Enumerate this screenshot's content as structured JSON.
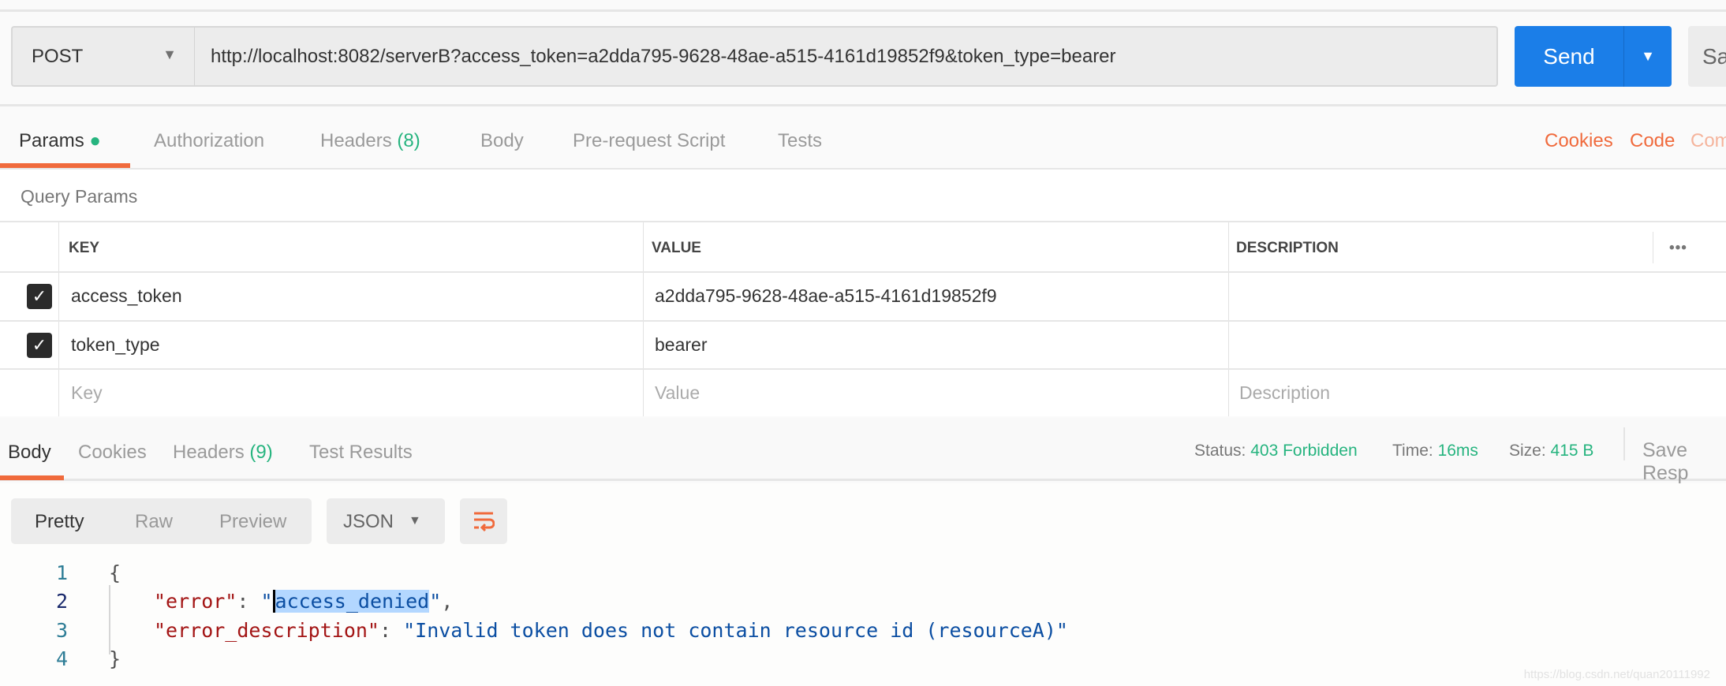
{
  "request": {
    "method": "POST",
    "url": "http://localhost:8082/serverB?access_token=a2dda795-9628-48ae-a515-4161d19852f9&token_type=bearer",
    "send_label": "Send",
    "save_label": "Sa"
  },
  "tabs": [
    {
      "label": "Params"
    },
    {
      "label": "Authorization"
    },
    {
      "label": "Headers",
      "count": "(8)"
    },
    {
      "label": "Body"
    },
    {
      "label": "Pre-request Script"
    },
    {
      "label": "Tests"
    }
  ],
  "right_links": {
    "cookies": "Cookies",
    "code": "Code",
    "comments": "Com"
  },
  "query_params": {
    "title": "Query Params",
    "headers": {
      "key": "KEY",
      "value": "VALUE",
      "description": "DESCRIPTION"
    },
    "rows": [
      {
        "checked": true,
        "key": "access_token",
        "value": "a2dda795-9628-48ae-a515-4161d19852f9"
      },
      {
        "checked": true,
        "key": "token_type",
        "value": "bearer"
      }
    ],
    "placeholders": {
      "key": "Key",
      "value": "Value",
      "description": "Description"
    },
    "more": "•••"
  },
  "response": {
    "tabs": [
      {
        "label": "Body"
      },
      {
        "label": "Cookies"
      },
      {
        "label": "Headers",
        "count": "(9)"
      },
      {
        "label": "Test Results"
      }
    ],
    "status_label": "Status:",
    "status": "403 Forbidden",
    "time_label": "Time:",
    "time": "16ms",
    "size_label": "Size:",
    "size": "415 B",
    "save": "Save Resp",
    "views": [
      "Pretty",
      "Raw",
      "Preview"
    ],
    "format": "JSON",
    "lines": [
      "1",
      "2",
      "3",
      "4"
    ],
    "code": {
      "open": "{",
      "k1": "\"error\"",
      "v1": "access_denied",
      "k2": "\"error_description\"",
      "v2": "\"Invalid token does not contain resource id (resourceA)\"",
      "close": "}"
    }
  },
  "watermark": "https://blog.csdn.net/quan20111992",
  "colors": {
    "accent": "#f06a3c",
    "send": "#1b7ee8",
    "success": "#26b47f"
  }
}
